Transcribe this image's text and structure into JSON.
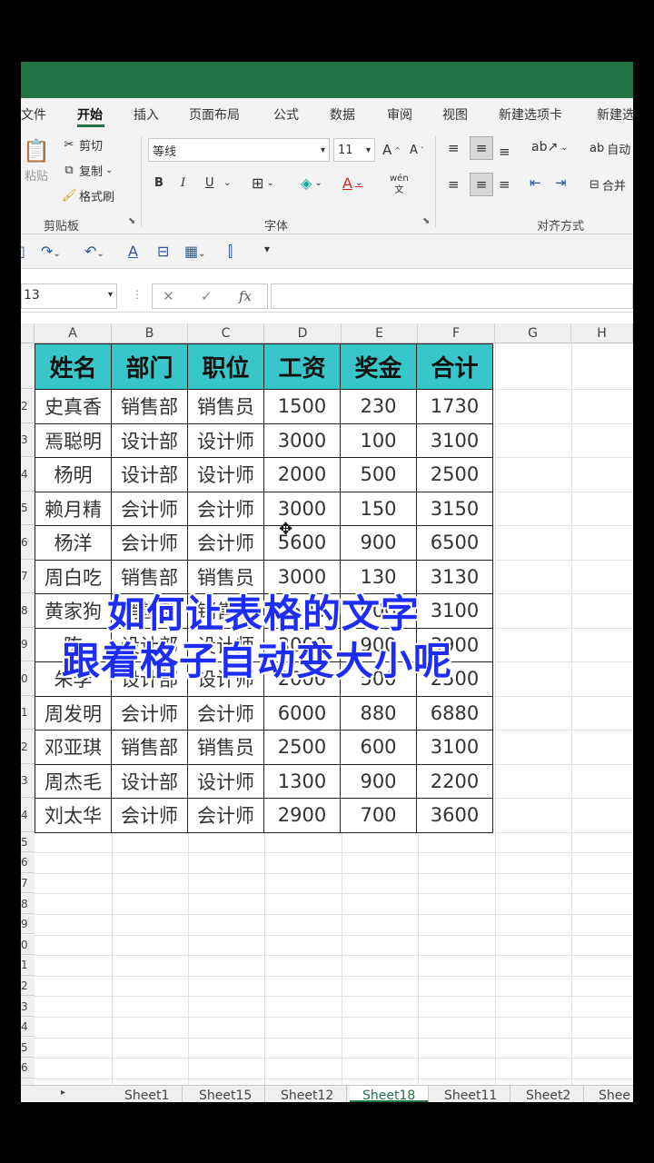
{
  "ribbon_tabs": [
    "文件",
    "开始",
    "插入",
    "页面布局",
    "公式",
    "数据",
    "审阅",
    "视图",
    "新建选项卡",
    "新建选"
  ],
  "clipboard": {
    "paste": "粘贴",
    "cut": "剪切",
    "copy": "复制",
    "format_painter": "格式刷",
    "group": "剪贴板"
  },
  "font": {
    "name": "等线",
    "size": "11",
    "bold": "B",
    "italic": "I",
    "underline": "U",
    "phonetic": "wén",
    "group": "字体"
  },
  "alignment": {
    "wrap_text": "自动",
    "merge": "合并",
    "group": "对齐方式"
  },
  "name_box": "13",
  "formula_bar": {
    "fx": "fx",
    "cancel": "✕",
    "enter": "✓",
    "value": ""
  },
  "columns": [
    "A",
    "B",
    "C",
    "D",
    "E",
    "F",
    "G",
    "H"
  ],
  "row_numbers": [
    "",
    "2",
    "3",
    "4",
    "5",
    "6",
    "7",
    "8",
    "9",
    "0",
    "1",
    "2",
    "3",
    "4",
    "5",
    "6",
    "7",
    "8",
    "9",
    "0",
    "1",
    "2",
    "3",
    "4",
    "5",
    "6",
    ""
  ],
  "table": {
    "headers": [
      "姓名",
      "部门",
      "职位",
      "工资",
      "奖金",
      "合计"
    ],
    "rows": [
      [
        "史真香",
        "销售部",
        "销售员",
        "1500",
        "230",
        "1730"
      ],
      [
        "焉聪明",
        "设计部",
        "设计师",
        "3000",
        "100",
        "3100"
      ],
      [
        "杨明",
        "设计部",
        "设计师",
        "2000",
        "500",
        "2500"
      ],
      [
        "赖月精",
        "会计师",
        "会计师",
        "3000",
        "150",
        "3150"
      ],
      [
        "杨洋",
        "会计师",
        "会计师",
        "5600",
        "900",
        "6500"
      ],
      [
        "周白吃",
        "销售部",
        "销售员",
        "3000",
        "130",
        "3130"
      ],
      [
        "黄家狗",
        "销售部",
        "销售员",
        "2500",
        "600",
        "3100"
      ],
      [
        "陈",
        "设计部",
        "设计师",
        "3000",
        "900",
        "3900"
      ],
      [
        "朱李",
        "设计部",
        "设计师",
        "2000",
        "500",
        "2500"
      ],
      [
        "周发明",
        "会计师",
        "会计师",
        "6000",
        "880",
        "6880"
      ],
      [
        "邓亚琪",
        "销售部",
        "销售员",
        "2500",
        "600",
        "3100"
      ],
      [
        "周杰毛",
        "设计部",
        "设计师",
        "1300",
        "900",
        "2200"
      ],
      [
        "刘太华",
        "会计师",
        "会计师",
        "2900",
        "700",
        "3600"
      ]
    ]
  },
  "sheets": [
    "Sheet1",
    "Sheet15",
    "Sheet12",
    "Sheet18",
    "Sheet11",
    "Sheet2",
    "Shee"
  ],
  "active_sheet": "Sheet18",
  "caption": {
    "line1": "如何让表格的文字",
    "line2": "跟着格子自动变大小呢"
  },
  "colors": {
    "excel_green": "#217346",
    "header_fill": "#39c6c9",
    "caption": "#1e2df5"
  }
}
